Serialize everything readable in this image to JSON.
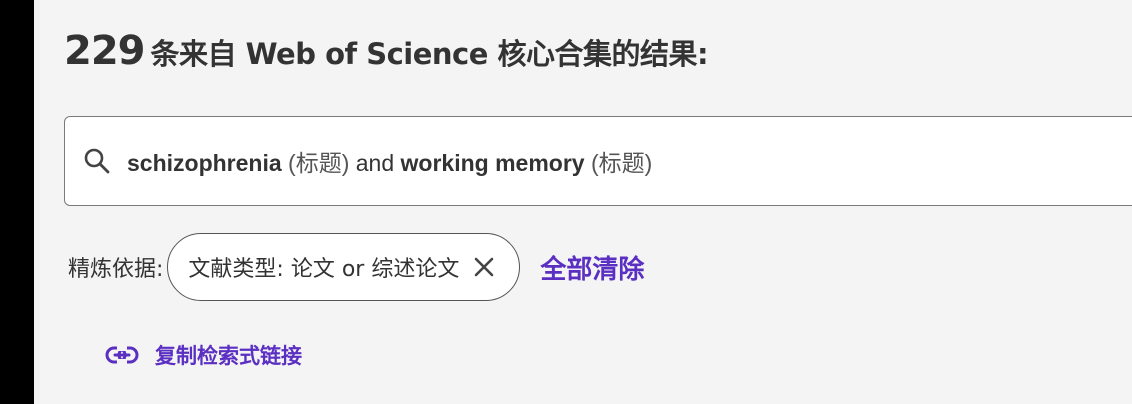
{
  "colors": {
    "accent": "#5a2fc2",
    "text": "#333333",
    "background": "#f4f4f4"
  },
  "results": {
    "count": "229",
    "title_suffix": "条来自 Web of Science 核心合集的结果:"
  },
  "query": {
    "icon": "search-icon",
    "term1": "schizophrenia",
    "field1": "(标题)",
    "operator": "and",
    "term2": "working memory",
    "field2": "(标题)"
  },
  "refine": {
    "label": "精炼依据:",
    "filter_chip": {
      "label": "文献类型: 论文 or 综述论文",
      "close_icon": "close-icon"
    },
    "clear_all_label": "全部清除"
  },
  "copy_link": {
    "icon": "link-icon",
    "label": "复制检索式链接"
  }
}
